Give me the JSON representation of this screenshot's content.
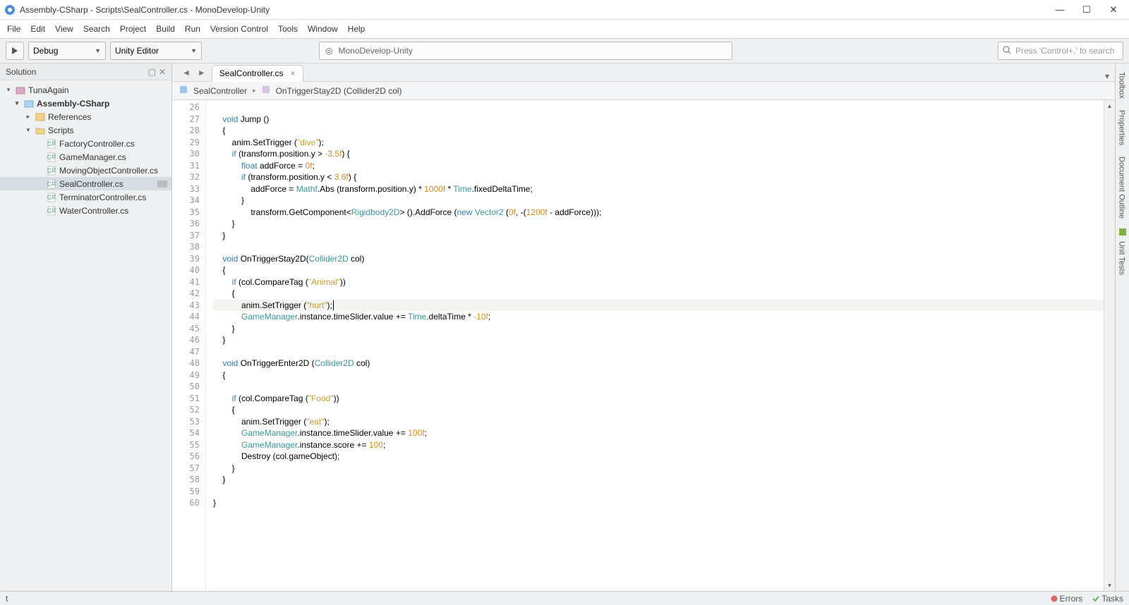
{
  "title": "Assembly-CSharp - Scripts\\SealController.cs - MonoDevelop-Unity",
  "menu": [
    "File",
    "Edit",
    "View",
    "Search",
    "Project",
    "Build",
    "Run",
    "Version Control",
    "Tools",
    "Window",
    "Help"
  ],
  "toolbar": {
    "config": "Debug",
    "target": "Unity Editor",
    "info": "MonoDevelop-Unity",
    "search_placeholder": "Press 'Control+,' to search"
  },
  "solution": {
    "header": "Solution",
    "tree": [
      {
        "depth": 0,
        "exp": "▾",
        "icon": "solution",
        "label": "TunaAgain",
        "bold": false
      },
      {
        "depth": 1,
        "exp": "▾",
        "icon": "project",
        "label": "Assembly-CSharp",
        "bold": true
      },
      {
        "depth": 2,
        "exp": "▸",
        "icon": "references",
        "label": "References",
        "bold": false
      },
      {
        "depth": 2,
        "exp": "▾",
        "icon": "folder",
        "label": "Scripts",
        "bold": false
      },
      {
        "depth": 3,
        "exp": "",
        "icon": "cs",
        "label": "FactoryController.cs",
        "bold": false
      },
      {
        "depth": 3,
        "exp": "",
        "icon": "cs",
        "label": "GameManager.cs",
        "bold": false
      },
      {
        "depth": 3,
        "exp": "",
        "icon": "cs",
        "label": "MovingObjectController.cs",
        "bold": false
      },
      {
        "depth": 3,
        "exp": "",
        "icon": "cs",
        "label": "SealController.cs",
        "bold": false,
        "sel": true,
        "chip": true
      },
      {
        "depth": 3,
        "exp": "",
        "icon": "cs",
        "label": "TerminatorController.cs",
        "bold": false
      },
      {
        "depth": 3,
        "exp": "",
        "icon": "cs",
        "label": "WaterController.cs",
        "bold": false
      }
    ]
  },
  "tab": {
    "name": "SealController.cs"
  },
  "breadcrumb": {
    "class": "SealController",
    "method": "OnTriggerStay2D (Collider2D col)"
  },
  "code": {
    "first_line": 26,
    "current_line": 43,
    "lines": [
      {
        "n": 26,
        "tokens": []
      },
      {
        "n": 27,
        "tokens": [
          {
            "t": "    "
          },
          {
            "t": "void",
            "c": "kw"
          },
          {
            "t": " Jump ()"
          }
        ]
      },
      {
        "n": 28,
        "tokens": [
          {
            "t": "    {"
          }
        ]
      },
      {
        "n": 29,
        "tokens": [
          {
            "t": "        anim.SetTrigger ("
          },
          {
            "t": "\"dive\"",
            "c": "str"
          },
          {
            "t": ");"
          }
        ]
      },
      {
        "n": 30,
        "tokens": [
          {
            "t": "        "
          },
          {
            "t": "if",
            "c": "kw"
          },
          {
            "t": " (transform.position.y > "
          },
          {
            "t": "-3.5f",
            "c": "num"
          },
          {
            "t": ") {"
          }
        ]
      },
      {
        "n": 31,
        "tokens": [
          {
            "t": "            "
          },
          {
            "t": "float",
            "c": "kw"
          },
          {
            "t": " addForce = "
          },
          {
            "t": "0f",
            "c": "num"
          },
          {
            "t": ";"
          }
        ]
      },
      {
        "n": 32,
        "tokens": [
          {
            "t": "            "
          },
          {
            "t": "if",
            "c": "kw"
          },
          {
            "t": " (transform.position.y < "
          },
          {
            "t": "3.6f",
            "c": "num"
          },
          {
            "t": ") {"
          }
        ]
      },
      {
        "n": 33,
        "tokens": [
          {
            "t": "                addForce = "
          },
          {
            "t": "Mathf",
            "c": "cls"
          },
          {
            "t": ".Abs (transform.position.y) * "
          },
          {
            "t": "1000f",
            "c": "num"
          },
          {
            "t": " * "
          },
          {
            "t": "Time",
            "c": "cls"
          },
          {
            "t": ".fixedDeltaTime;"
          }
        ]
      },
      {
        "n": 34,
        "tokens": [
          {
            "t": "            }"
          }
        ]
      },
      {
        "n": 35,
        "tokens": [
          {
            "t": "                transform.GetComponent<"
          },
          {
            "t": "Rigidbody2D",
            "c": "cls"
          },
          {
            "t": "> ().AddForce ("
          },
          {
            "t": "new",
            "c": "kw"
          },
          {
            "t": " "
          },
          {
            "t": "Vector2",
            "c": "cls"
          },
          {
            "t": " ("
          },
          {
            "t": "0f",
            "c": "num"
          },
          {
            "t": ", -("
          },
          {
            "t": "1200f",
            "c": "num"
          },
          {
            "t": " - addForce)));"
          }
        ]
      },
      {
        "n": 36,
        "tokens": [
          {
            "t": "        }"
          }
        ]
      },
      {
        "n": 37,
        "tokens": [
          {
            "t": "    }"
          }
        ]
      },
      {
        "n": 38,
        "tokens": []
      },
      {
        "n": 39,
        "tokens": [
          {
            "t": "    "
          },
          {
            "t": "void",
            "c": "kw"
          },
          {
            "t": " OnTriggerStay2D("
          },
          {
            "t": "Collider2D",
            "c": "cls"
          },
          {
            "t": " col)"
          }
        ]
      },
      {
        "n": 40,
        "tokens": [
          {
            "t": "    {"
          }
        ]
      },
      {
        "n": 41,
        "tokens": [
          {
            "t": "        "
          },
          {
            "t": "if",
            "c": "kw"
          },
          {
            "t": " (col.CompareTag ("
          },
          {
            "t": "\"Animal\"",
            "c": "str"
          },
          {
            "t": "))"
          }
        ]
      },
      {
        "n": 42,
        "tokens": [
          {
            "t": "        {"
          }
        ]
      },
      {
        "n": 43,
        "tokens": [
          {
            "t": "            anim.SetTrigger ("
          },
          {
            "t": "\"hurt\"",
            "c": "str"
          },
          {
            "t": ");"
          }
        ],
        "caret": true
      },
      {
        "n": 44,
        "tokens": [
          {
            "t": "            "
          },
          {
            "t": "GameManager",
            "c": "cls"
          },
          {
            "t": ".instance.timeSlider.value += "
          },
          {
            "t": "Time",
            "c": "cls"
          },
          {
            "t": ".deltaTime * "
          },
          {
            "t": "-10f",
            "c": "num"
          },
          {
            "t": ";"
          }
        ]
      },
      {
        "n": 45,
        "tokens": [
          {
            "t": "        }"
          }
        ]
      },
      {
        "n": 46,
        "tokens": [
          {
            "t": "    }"
          }
        ]
      },
      {
        "n": 47,
        "tokens": []
      },
      {
        "n": 48,
        "tokens": [
          {
            "t": "    "
          },
          {
            "t": "void",
            "c": "kw"
          },
          {
            "t": " OnTriggerEnter2D ("
          },
          {
            "t": "Collider2D",
            "c": "cls"
          },
          {
            "t": " col)"
          }
        ]
      },
      {
        "n": 49,
        "tokens": [
          {
            "t": "    {"
          }
        ]
      },
      {
        "n": 50,
        "tokens": []
      },
      {
        "n": 51,
        "tokens": [
          {
            "t": "        "
          },
          {
            "t": "if",
            "c": "kw"
          },
          {
            "t": " (col.CompareTag ("
          },
          {
            "t": "\"Food\"",
            "c": "str"
          },
          {
            "t": "))"
          }
        ]
      },
      {
        "n": 52,
        "tokens": [
          {
            "t": "        {"
          }
        ]
      },
      {
        "n": 53,
        "tokens": [
          {
            "t": "            anim.SetTrigger ("
          },
          {
            "t": "\"eat\"",
            "c": "str"
          },
          {
            "t": ");"
          }
        ]
      },
      {
        "n": 54,
        "tokens": [
          {
            "t": "            "
          },
          {
            "t": "GameManager",
            "c": "cls"
          },
          {
            "t": ".instance.timeSlider.value += "
          },
          {
            "t": "100f",
            "c": "num"
          },
          {
            "t": ";"
          }
        ]
      },
      {
        "n": 55,
        "tokens": [
          {
            "t": "            "
          },
          {
            "t": "GameManager",
            "c": "cls"
          },
          {
            "t": ".instance.score += "
          },
          {
            "t": "100",
            "c": "num"
          },
          {
            "t": ";"
          }
        ]
      },
      {
        "n": 56,
        "tokens": [
          {
            "t": "            Destroy (col.gameObject);"
          }
        ]
      },
      {
        "n": 57,
        "tokens": [
          {
            "t": "        }"
          }
        ]
      },
      {
        "n": 58,
        "tokens": [
          {
            "t": "    }"
          }
        ]
      },
      {
        "n": 59,
        "tokens": []
      },
      {
        "n": 60,
        "tokens": [
          {
            "t": "}"
          }
        ]
      }
    ]
  },
  "rails": [
    "Toolbox",
    "Properties",
    "Document Outline",
    "Unit Tests"
  ],
  "status": {
    "errors": "Errors",
    "tasks": "Tasks"
  }
}
